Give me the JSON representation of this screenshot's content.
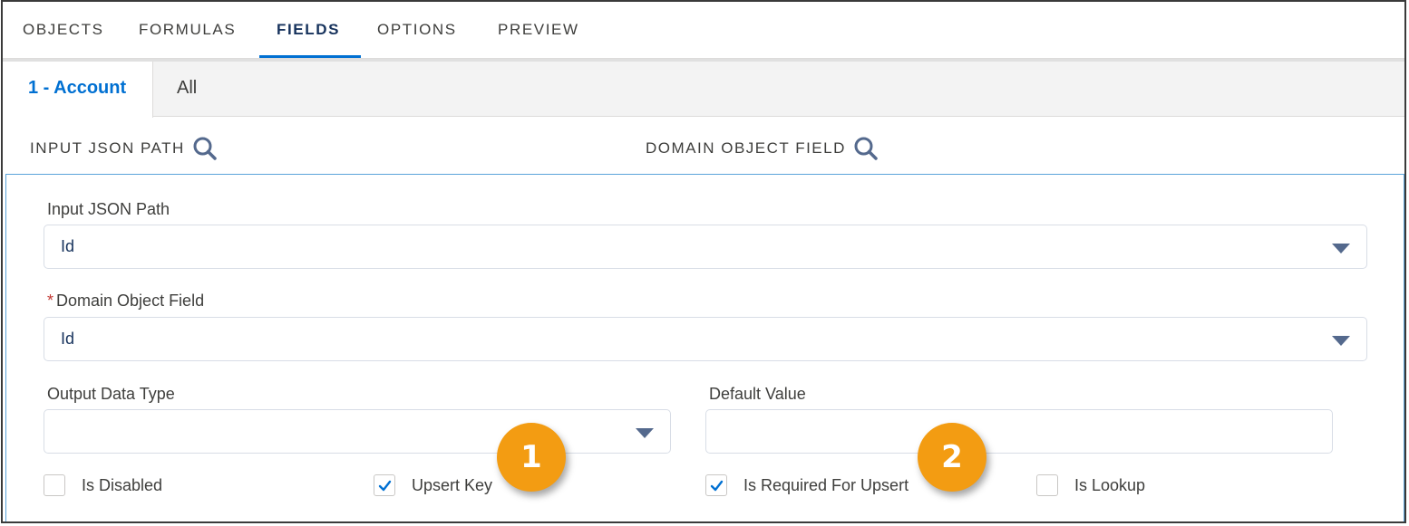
{
  "top_tabs": [
    {
      "label": "OBJECTS"
    },
    {
      "label": "FORMULAS"
    },
    {
      "label": "FIELDS"
    },
    {
      "label": "OPTIONS"
    },
    {
      "label": "PREVIEW"
    }
  ],
  "active_top_tab": "FIELDS",
  "sub_tabs": [
    {
      "label": "1 - Account"
    },
    {
      "label": "All"
    }
  ],
  "columns": {
    "input_path": "INPUT JSON PATH",
    "domain_field": "DOMAIN OBJECT FIELD"
  },
  "form": {
    "input_json_path_label": "Input JSON Path",
    "input_json_path_value": "Id",
    "required_marker": "*",
    "domain_object_field_label": "Domain Object Field",
    "domain_object_field_value": "Id",
    "output_data_type_label": "Output Data Type",
    "output_data_type_value": "",
    "default_value_label": "Default Value",
    "default_value_value": ""
  },
  "checkboxes": [
    {
      "label": "Is Disabled",
      "checked": false
    },
    {
      "label": "Upsert Key",
      "checked": true
    },
    {
      "label": "Is Required For Upsert",
      "checked": true
    },
    {
      "label": "Is Lookup",
      "checked": false
    }
  ],
  "callouts": [
    "1",
    "2"
  ],
  "colors": {
    "accent": "#0070d2",
    "callout": "#f39c12",
    "required": "#c23934",
    "panel_border": "#5aa3da"
  }
}
